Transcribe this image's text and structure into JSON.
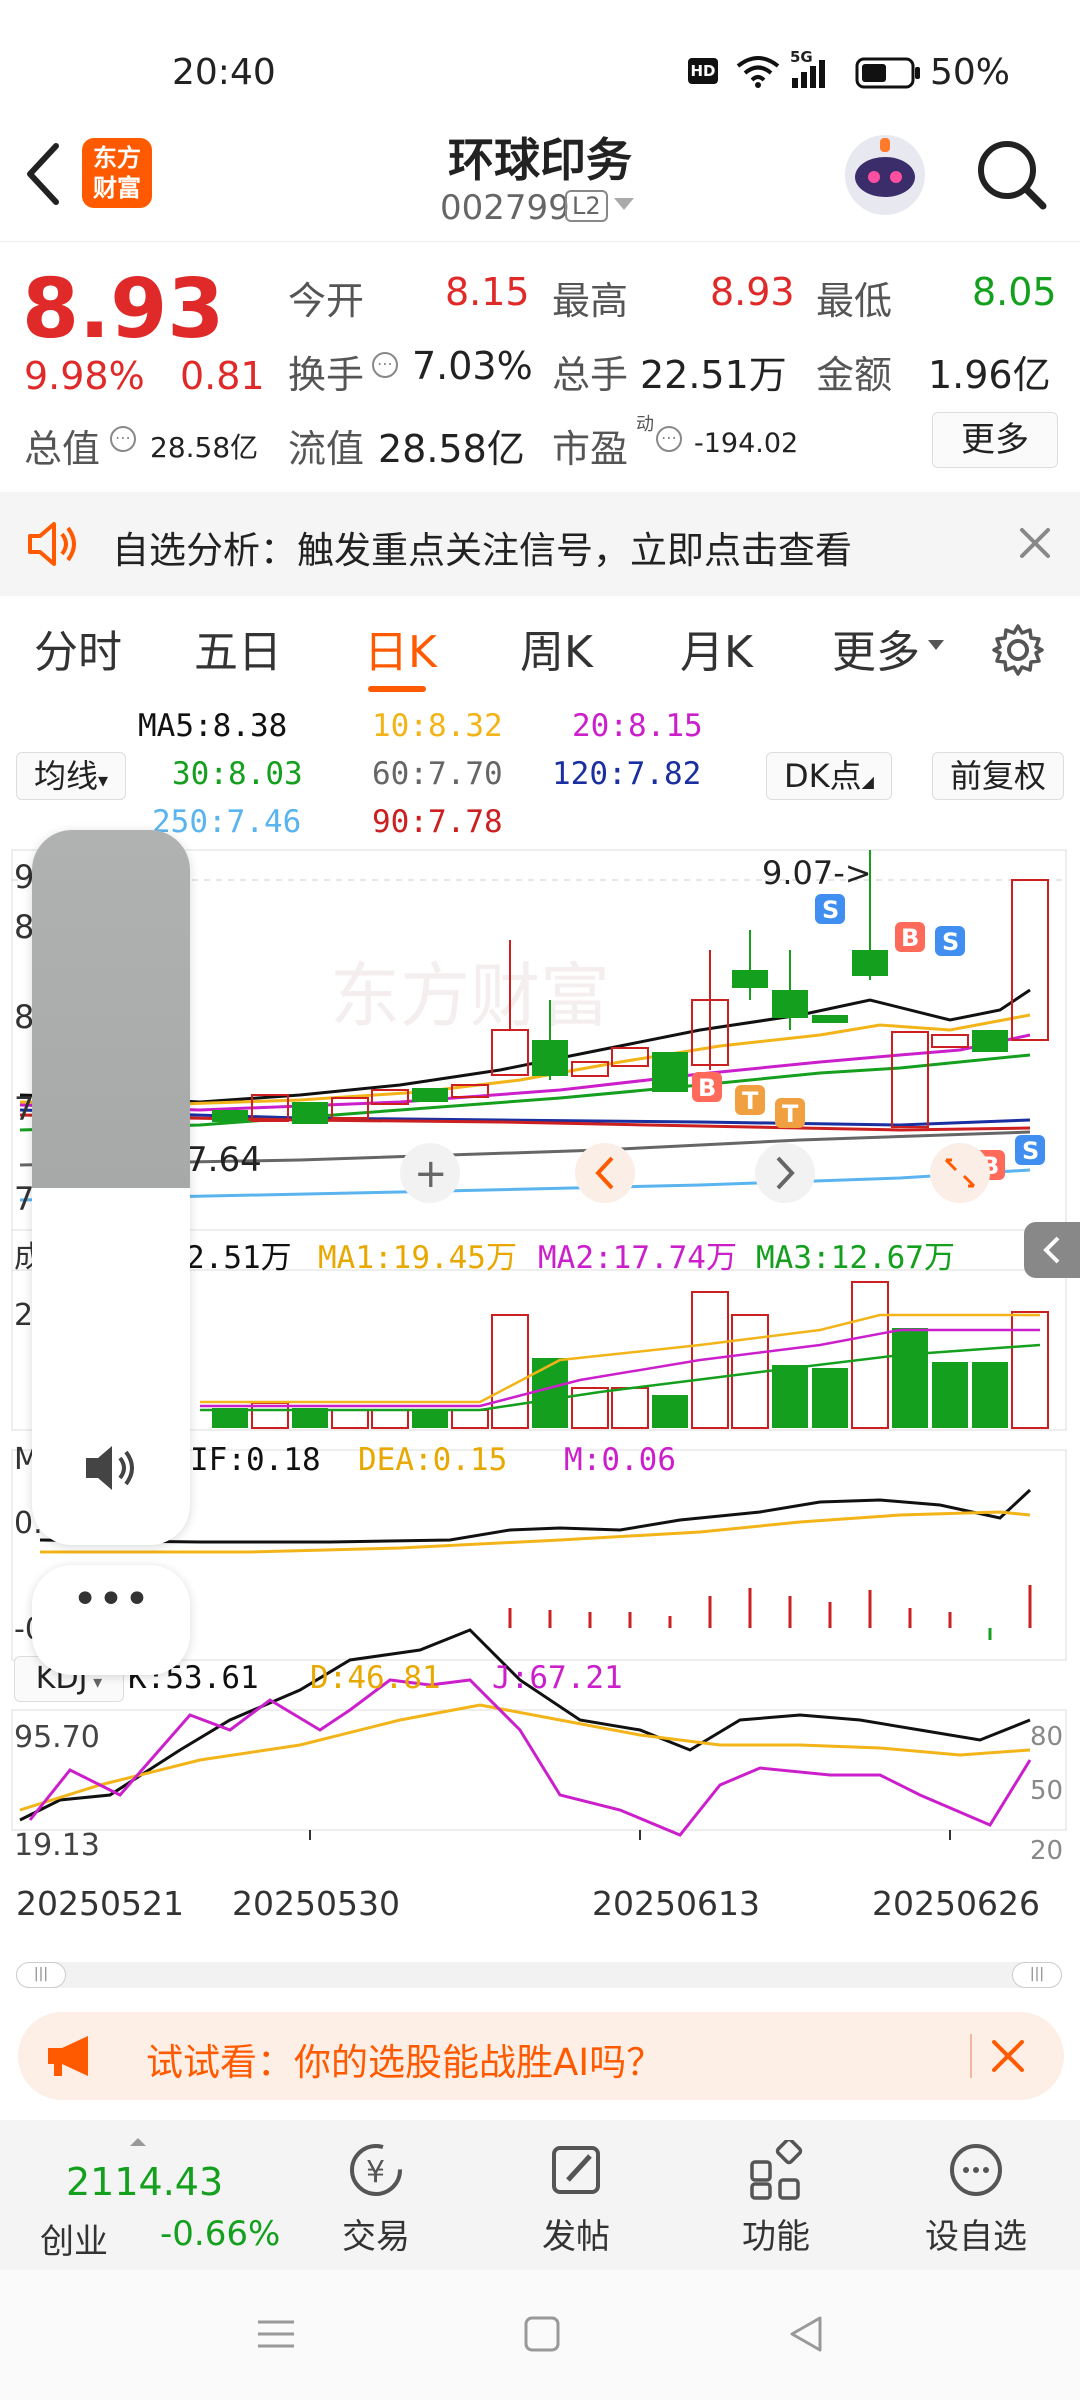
{
  "status": {
    "time": "20:40",
    "battery": "50%",
    "network": "5G",
    "hd": "HD"
  },
  "header": {
    "title": "环球印务",
    "code": "002799",
    "level": "L2",
    "logo_text": "东方财富"
  },
  "quote": {
    "price": "8.93",
    "change_pct": "9.98%",
    "change": "0.81",
    "open_label": "今开",
    "open": "8.15",
    "high_label": "最高",
    "high": "8.93",
    "low_label": "最低",
    "low": "8.05",
    "turnover_label": "换手",
    "turnover": "7.03%",
    "volume_label": "总手",
    "volume": "22.51万",
    "amount_label": "金额",
    "amount": "1.96亿",
    "mcap_label": "总值",
    "mcap": "28.58亿",
    "float_label": "流值",
    "float": "28.58亿",
    "pe_label": "市盈",
    "pe_sup": "动",
    "pe": "-194.02",
    "more": "更多"
  },
  "ticker": {
    "text": "自选分析：触发重点关注信号，立即点击查看"
  },
  "tabs": [
    "分时",
    "五日",
    "日K",
    "周K",
    "月K",
    "更多"
  ],
  "ma": {
    "ma5": "MA5:8.38",
    "ma10": "10:8.32",
    "ma20": "20:8.15",
    "ma30": "30:8.03",
    "ma60": "60:7.70",
    "ma120": "120:7.82",
    "ma250": "250:7.46",
    "ma90": "90:7.78",
    "btn_line": "均线",
    "btn_dk": "DK点",
    "btn_fq": "前复权"
  },
  "chart_labels": {
    "peak": "9.07->",
    "low": "7.64",
    "y_top": "9",
    "y2": "8",
    "y3": "8",
    "y4": "7",
    "y5": "7"
  },
  "vol": {
    "v": "2.51万",
    "ma1": "MA1:19.45万",
    "ma2": "MA2:17.74万",
    "ma3": "MA3:12.67万",
    "y": "2",
    "tag": "成"
  },
  "macd": {
    "dif": "IF:0.18",
    "dea": "DEA:0.15",
    "m": "M:0.06",
    "y1": "0.",
    "y2": "-0",
    "tag": "M"
  },
  "kdj": {
    "name": "KDJ",
    "k": "K:53.61",
    "d": "D:46.81",
    "j": "J:67.21",
    "y_hi": "95.70",
    "y_lo": "19.13",
    "r80": "80",
    "r50": "50",
    "r20": "20"
  },
  "dates": [
    "20250521",
    "20250530",
    "20250613",
    "20250626"
  ],
  "promo": {
    "text": "试试看：你的选股能战胜AI吗？"
  },
  "nav": {
    "index_value": "2114.43",
    "index_name": "创业",
    "index_change": "-0.66%",
    "items": [
      "交易",
      "发帖",
      "功能",
      "设自选"
    ]
  },
  "colors": {
    "brand": "#ff5a00",
    "up": "#e02a2a",
    "down": "#14a01e",
    "ma5": "#111111",
    "ma10": "#f2b418",
    "ma20": "#cc1fcc",
    "ma30": "#14a01e",
    "ma60": "#666666",
    "ma120": "#1a2fa0",
    "ma250": "#5ab4f0",
    "ma90": "#cc2020"
  }
}
